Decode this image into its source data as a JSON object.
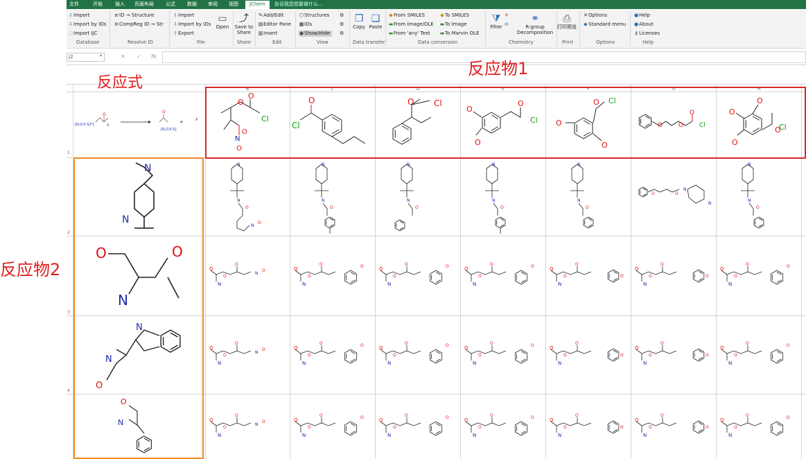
{
  "tabs": [
    {
      "label": "文件"
    },
    {
      "label": "开始"
    },
    {
      "label": "插入"
    },
    {
      "label": "页面布局"
    },
    {
      "label": "公式"
    },
    {
      "label": "数据"
    },
    {
      "label": "审阅"
    },
    {
      "label": "视图"
    },
    {
      "label": "JChem"
    },
    {
      "label": "告诉我您想要做什么..."
    }
  ],
  "ribbon": {
    "database": {
      "import": "Import",
      "import_ids": "Import by IDs",
      "import_ijc": "Import IJC",
      "group": "Database"
    },
    "resolve": {
      "id_structure": "ID → Structure",
      "compreg": "CompReg ID → Str",
      "group": "Resolve ID"
    },
    "file": {
      "import": "Import",
      "import_ids": "Import by IDs",
      "export": "Export",
      "open": "Open",
      "group": "File"
    },
    "share": {
      "save_to_share": "Save to Share",
      "group": "Share"
    },
    "edit": {
      "add_edit": "Add/Edit",
      "editor_pane": "Editor Pane",
      "insert": "Insert",
      "group": "Edit"
    },
    "view": {
      "structures": "Structures",
      "ids": "IDs",
      "show_hide": "Show/Hide",
      "group": "View"
    },
    "transfer": {
      "copy": "Copy",
      "paste": "Paste",
      "group": "Data transfer"
    },
    "conversion": {
      "from_smiles": "From SMILES",
      "from_image": "From Image/OLE",
      "from_any": "From 'any' Text",
      "to_smiles": "To SMILES",
      "to_image": "To Image",
      "to_marvin": "To Marvin OLE",
      "group": "Data conversion"
    },
    "chemistry": {
      "filter": "Filter",
      "rgroup": "R-group Decomposition",
      "group": "Chemistry"
    },
    "print": {
      "print": "打印预览",
      "group": "Print"
    },
    "options": {
      "options": "Options",
      "standard_menu": "Standard menu",
      "group": "Options"
    },
    "help": {
      "help": "Help",
      "about": "About",
      "licenses": "Licenses",
      "group": "Help"
    }
  },
  "formula_bar": {
    "name_box": "J2",
    "fx": "fx"
  },
  "annotations": {
    "reaction_label": "反应式",
    "reactant1_label": "反应物1",
    "reactant2_label": "反应物2"
  },
  "column_headers": [
    "B",
    "C",
    "D",
    "E",
    "F",
    "G",
    "H"
  ],
  "row_numbers": [
    "1",
    "2",
    "3",
    "4"
  ],
  "reaction_template": {
    "r_label": "[N,O,P,S]*1",
    "x_label": "X",
    "p_label": "[N,O,P,S]",
    "plus": "+"
  },
  "atom_labels": {
    "N": "N",
    "O": "O",
    "Cl": "Cl"
  },
  "colors": {
    "accent": "#217346",
    "red_box": "#d62828",
    "orange_box": "#f08a24",
    "annotation": "#e02020",
    "nitrogen": "#1f2aa8",
    "oxygen": "#e01010",
    "chlorine": "#0a9a0a"
  }
}
